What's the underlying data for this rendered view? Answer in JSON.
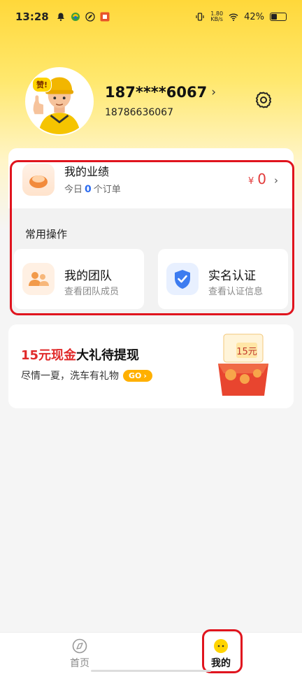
{
  "status_bar": {
    "time": "13:28",
    "network_speed_value": "1.80",
    "network_speed_unit": "KB/s",
    "battery": "42%",
    "battery_level": 0.42
  },
  "profile": {
    "name": "187****6067",
    "phone": "18786636067",
    "badge": "赞!"
  },
  "performance": {
    "title": "我的业绩",
    "sub_prefix": "今日",
    "order_count": "0",
    "sub_suffix": "个订单",
    "currency": "¥",
    "amount": "0"
  },
  "common_ops": {
    "title": "常用操作",
    "items": [
      {
        "title": "我的团队",
        "subtitle": "查看团队成员"
      },
      {
        "title": "实名认证",
        "subtitle": "查看认证信息"
      }
    ]
  },
  "promo": {
    "title_highlight": "15元现金",
    "title_rest": "大礼待提现",
    "subtitle": "尽情一夏，洗车有礼物",
    "go_label": "GO",
    "gift_label": "15元"
  },
  "nav": {
    "items": [
      {
        "label": "首页"
      },
      {
        "label": "我的"
      }
    ]
  },
  "colors": {
    "accent_yellow": "#ffd83a",
    "highlight_red": "#e02a2a",
    "annotation_red": "#e0141e",
    "count_blue": "#2d6cf0"
  }
}
